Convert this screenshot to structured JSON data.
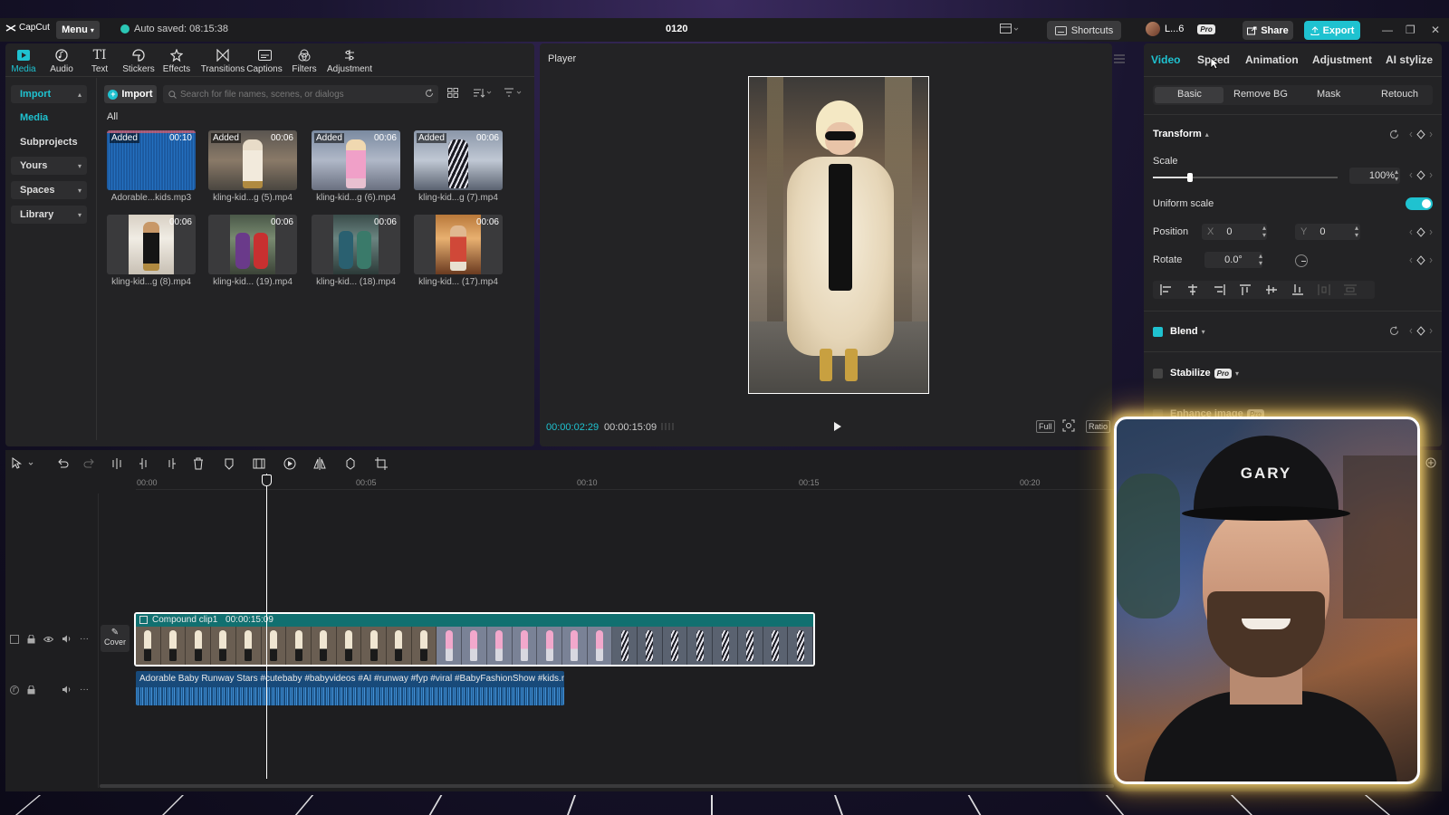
{
  "app": {
    "logo": "CapCut",
    "menu_label": "Menu",
    "autosave": "Auto saved: 08:15:38",
    "project_title": "0120",
    "shortcuts_label": "Shortcuts",
    "user_label": "L...6",
    "pro_badge": "Pro",
    "share_label": "Share",
    "export_label": "Export",
    "accent": "#1fc2d0"
  },
  "toolbar": {
    "tabs": [
      {
        "label": "Media",
        "icon": "media-icon"
      },
      {
        "label": "Audio",
        "icon": "audio-icon"
      },
      {
        "label": "Text",
        "icon": "text-icon"
      },
      {
        "label": "Stickers",
        "icon": "sticker-icon"
      },
      {
        "label": "Effects",
        "icon": "effects-icon"
      },
      {
        "label": "Transitions",
        "icon": "transitions-icon"
      },
      {
        "label": "Captions",
        "icon": "captions-icon"
      },
      {
        "label": "Filters",
        "icon": "filters-icon"
      },
      {
        "label": "Adjustment",
        "icon": "adjustment-icon"
      }
    ]
  },
  "sidebar": {
    "items": [
      "Import",
      "Media",
      "Subprojects",
      "Yours",
      "Spaces",
      "Library"
    ]
  },
  "media": {
    "import_label": "Import",
    "search_placeholder": "Search for file names, scenes, or dialogs",
    "filter_label": "All",
    "added_label": "Added",
    "items": [
      {
        "name": "Adorable...kids.mp3",
        "duration": "00:10",
        "added": true
      },
      {
        "name": "kling-kid...g (5).mp4",
        "duration": "00:06",
        "added": true
      },
      {
        "name": "kling-kid...g (6).mp4",
        "duration": "00:06",
        "added": true
      },
      {
        "name": "kling-kid...g (7).mp4",
        "duration": "00:06",
        "added": true
      },
      {
        "name": "kling-kid...g (8).mp4",
        "duration": "00:06",
        "added": false
      },
      {
        "name": "kling-kid... (19).mp4",
        "duration": "00:06",
        "added": false
      },
      {
        "name": "kling-kid... (18).mp4",
        "duration": "00:06",
        "added": false
      },
      {
        "name": "kling-kid... (17).mp4",
        "duration": "00:06",
        "added": false
      }
    ]
  },
  "player": {
    "title": "Player",
    "current_time": "00:00:02:29",
    "total_time": "00:00:15:09",
    "full_label": "Full",
    "ratio_label": "Ratio"
  },
  "inspector": {
    "tabs": [
      "Video",
      "Speed",
      "Animation",
      "Adjustment",
      "AI stylize"
    ],
    "subtabs": [
      "Basic",
      "Remove BG",
      "Mask",
      "Retouch"
    ],
    "transform_label": "Transform",
    "scale_label": "Scale",
    "scale_value": "100%",
    "scale_fraction": 0.2,
    "uniform_scale_label": "Uniform scale",
    "position_label": "Position",
    "x_label": "X",
    "x_value": "0",
    "y_label": "Y",
    "y_value": "0",
    "rotate_label": "Rotate",
    "rotate_value": "0.0°",
    "blend_label": "Blend",
    "stabilize_label": "Stabilize",
    "enhance_label": "Enhance image",
    "pro_badge": "Pro"
  },
  "timeline": {
    "ruler": [
      "00:00",
      "00:05",
      "00:10",
      "00:15",
      "00:20"
    ],
    "cover_label": "Cover",
    "video_clip_name": "Compound clip1",
    "video_clip_duration": "00:00:15:09",
    "audio_clip_name": "Adorable Baby Runway Stars #cutebaby #babyvideos #AI #runway #fyp #viral #BabyFashionShow #kids.mp"
  },
  "webcam": {
    "cap_text": "GARY"
  }
}
